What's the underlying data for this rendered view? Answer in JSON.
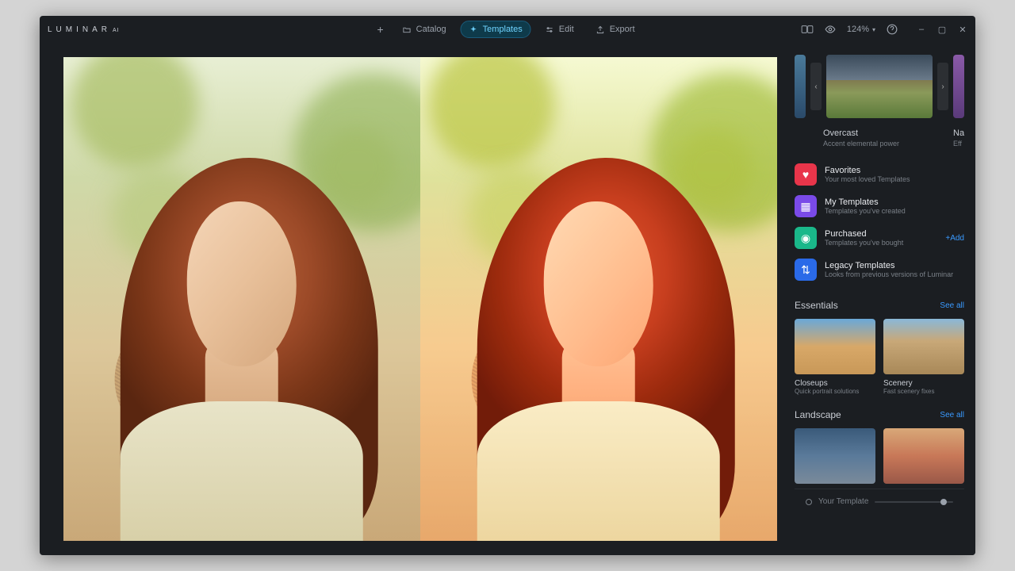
{
  "app": {
    "name": "LUMINAR",
    "suffix": "AI"
  },
  "toolbar": {
    "catalog": "Catalog",
    "templates": "Templates",
    "edit": "Edit",
    "export": "Export",
    "zoom": "124%"
  },
  "carousel": {
    "main": {
      "title": "Overcast",
      "subtitle": "Accent elemental power"
    },
    "next": {
      "title": "Na",
      "subtitle": "Eff"
    }
  },
  "library": [
    {
      "title": "Favorites",
      "subtitle": "Your most loved Templates",
      "icon": "heart",
      "color": "red"
    },
    {
      "title": "My Templates",
      "subtitle": "Templates you've created",
      "icon": "grid",
      "color": "purple"
    },
    {
      "title": "Purchased",
      "subtitle": "Templates you've bought",
      "icon": "tag",
      "color": "green",
      "action": "+Add"
    },
    {
      "title": "Legacy Templates",
      "subtitle": "Looks from previous versions of Luminar",
      "icon": "arrows",
      "color": "blue"
    }
  ],
  "sections": {
    "essentials": {
      "title": "Essentials",
      "see_all": "See all",
      "items": [
        {
          "title": "Closeups",
          "subtitle": "Quick portrait solutions"
        },
        {
          "title": "Scenery",
          "subtitle": "Fast scenery fixes"
        }
      ]
    },
    "landscape": {
      "title": "Landscape",
      "see_all": "See all",
      "items": [
        {
          "title": "",
          "subtitle": ""
        },
        {
          "title": "",
          "subtitle": ""
        }
      ]
    }
  },
  "footer": {
    "label": "Your Template"
  }
}
